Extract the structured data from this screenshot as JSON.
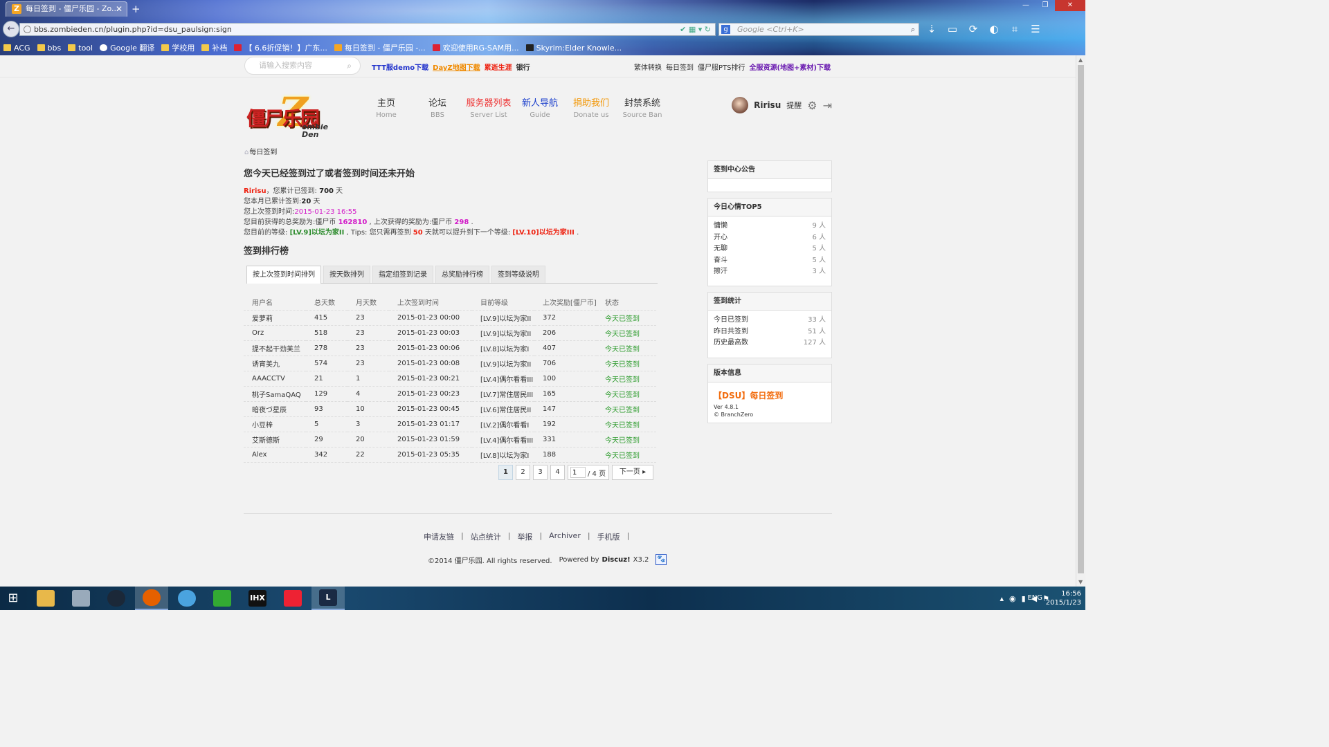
{
  "browser": {
    "tab_title": "每日签到 - 僵尸乐园 - Zo...",
    "tab_favicon": "Z",
    "url": "bbs.zombieden.cn/plugin.php?id=dsu_paulsign:sign",
    "search_placeholder": "Google <Ctrl+K>",
    "bookmarks": [
      {
        "label": "ACG",
        "icon": "folder-icon"
      },
      {
        "label": "bbs",
        "icon": "folder-icon"
      },
      {
        "label": "tool",
        "icon": "folder-icon"
      },
      {
        "label": "Google 翻译",
        "icon": "translate-icon"
      },
      {
        "label": "学校用",
        "icon": "folder-icon"
      },
      {
        "label": "补档",
        "icon": "folder-icon"
      },
      {
        "label": "【 6.6折促销！】广东...",
        "icon": "site-icon"
      },
      {
        "label": "每日签到 - 僵尸乐园 -...",
        "icon": "zombieden-icon"
      },
      {
        "label": "欢迎使用RG-SAM用...",
        "icon": "site-icon"
      },
      {
        "label": "Skyrim:Elder Knowle...",
        "icon": "skyrim-icon"
      }
    ]
  },
  "topstrip": {
    "search_placeholder": "请输入搜索内容",
    "quicklinks": [
      {
        "label": "TTT服demo下载",
        "style": "blue"
      },
      {
        "label": "DayZ地图下载",
        "style": "orange"
      },
      {
        "label": "累逝生涯",
        "style": "red"
      },
      {
        "label": "银行",
        "style": "dark"
      }
    ],
    "right_links": [
      "繁体转换",
      "每日签到",
      "僵尸服PTS排行"
    ],
    "right_highlight": "全服资源(地图+素材)下载"
  },
  "header": {
    "logo": {
      "cn": "僵尸乐园",
      "letter": "Z",
      "en_line1": "ombie",
      "en_line2": "Den"
    },
    "nav": [
      {
        "cn": "主页",
        "en": "Home",
        "style": ""
      },
      {
        "cn": "论坛",
        "en": "BBS",
        "style": ""
      },
      {
        "cn": "服务器列表",
        "en": "Server List",
        "style": "red"
      },
      {
        "cn": "新人导航",
        "en": "Guide",
        "style": "blue"
      },
      {
        "cn": "捐助我们",
        "en": "Donate us",
        "style": "orange"
      },
      {
        "cn": "封禁系统",
        "en": "Source Ban",
        "style": ""
      }
    ],
    "user": {
      "name": "Ririsu",
      "remind": "提醒"
    }
  },
  "breadcrumb": "每日签到",
  "status": {
    "heading": "您今天已经签到过了或者签到时间还未开始",
    "username": "Ririsu",
    "line1_a": "，您累计已签到: ",
    "total_days": "700",
    "line1_b": " 天",
    "line2_a": "您本月已累计签到:",
    "month_days": "20",
    "line2_b": " 天",
    "line3_a": "您上次签到时间:",
    "last_time": "2015-01-23 16:55",
    "line4_a": "您目前获得的总奖励为:僵尸币 ",
    "total_reward": "162810",
    "line4_b": " , 上次获得的奖励为:僵尸币 ",
    "last_reward": "298",
    "line4_c": " .",
    "line5_a": "您目前的等级: ",
    "level": "[LV.9]以坛为家II",
    "line5_b": " , Tips: 您只需再签到 ",
    "need_days": "50",
    "line5_c": " 天就可以提升到下一个等级: ",
    "next_level": "[LV.10]以坛为家III",
    "line5_d": " ."
  },
  "ranking": {
    "heading": "签到排行榜",
    "tabs": [
      "按上次签到时间排列",
      "按天数排列",
      "指定组签到记录",
      "总奖励排行榜",
      "签到等级说明"
    ],
    "columns": [
      "用户名",
      "总天数",
      "月天数",
      "上次签到时间",
      "目前等级",
      "上次奖励[僵尸币]",
      "状态"
    ],
    "rows": [
      [
        "爱萝莉",
        "415",
        "23",
        "2015-01-23 00:00",
        "[LV.9]以坛为家II",
        "372",
        "今天已签到"
      ],
      [
        "Orz",
        "518",
        "23",
        "2015-01-23 00:03",
        "[LV.9]以坛为家II",
        "206",
        "今天已签到"
      ],
      [
        "提不起干劲芙兰",
        "278",
        "23",
        "2015-01-23 00:06",
        "[LV.8]以坛为家I",
        "407",
        "今天已签到"
      ],
      [
        "诱宵美九",
        "574",
        "23",
        "2015-01-23 00:08",
        "[LV.9]以坛为家II",
        "706",
        "今天已签到"
      ],
      [
        "AAACCTV",
        "21",
        "1",
        "2015-01-23 00:21",
        "[LV.4]偶尔看看III",
        "100",
        "今天已签到"
      ],
      [
        "桃子SamaQAQ",
        "129",
        "4",
        "2015-01-23 00:23",
        "[LV.7]常住居民III",
        "165",
        "今天已签到"
      ],
      [
        "暗夜づ星辰",
        "93",
        "10",
        "2015-01-23 00:45",
        "[LV.6]常住居民II",
        "147",
        "今天已签到"
      ],
      [
        "小豆梓",
        "5",
        "3",
        "2015-01-23 01:17",
        "[LV.2]偶尔看看I",
        "192",
        "今天已签到"
      ],
      [
        "艾斯德斯",
        "29",
        "20",
        "2015-01-23 01:59",
        "[LV.4]偶尔看看III",
        "331",
        "今天已签到"
      ],
      [
        "Alex",
        "342",
        "22",
        "2015-01-23 05:35",
        "[LV.8]以坛为家I",
        "188",
        "今天已签到"
      ]
    ]
  },
  "pager": {
    "pages": [
      "1",
      "2",
      "3",
      "4"
    ],
    "current": "1",
    "jump_value": "1",
    "total": "/ 4 页",
    "next": "下一页"
  },
  "sidebar": {
    "notice_title": "签到中心公告",
    "mood_title": "今日心情TOP5",
    "moods": [
      {
        "label": "慵懒",
        "value": "9 人"
      },
      {
        "label": "开心",
        "value": "6 人"
      },
      {
        "label": "无聊",
        "value": "5 人"
      },
      {
        "label": "奋斗",
        "value": "5 人"
      },
      {
        "label": "擦汗",
        "value": "3 人"
      }
    ],
    "stats_title": "签到统计",
    "stats": [
      {
        "label": "今日已签到",
        "value": "33 人"
      },
      {
        "label": "昨日共签到",
        "value": "51 人"
      },
      {
        "label": "历史最高数",
        "value": "127 人"
      }
    ],
    "version_title": "版本信息",
    "version_name": "【DSU】每日签到",
    "version_ver": "Ver 4.8.1",
    "version_author": "© BranchZero"
  },
  "footer": {
    "links": [
      "申请友链",
      "站点统计",
      "举报",
      "Archiver",
      "手机版"
    ],
    "copyright": "©2014  僵尸乐园. All rights reserved.",
    "powered": "Powered by",
    "brand": "Discuz!",
    "version": "X3.2"
  },
  "taskbar": {
    "lang": "ENG",
    "time": "16:56",
    "date": "2015/1/23",
    "apps": [
      {
        "name": "file-explorer-icon",
        "label": "",
        "color": "#e8b84a"
      },
      {
        "name": "control-panel-icon",
        "label": "",
        "color": "#9ab"
      },
      {
        "name": "steam-icon",
        "label": "",
        "color": "#1b2838"
      },
      {
        "name": "firefox-icon",
        "label": "",
        "color": "#e66000"
      },
      {
        "name": "itunes-icon",
        "label": "",
        "color": "#4aa3df"
      },
      {
        "name": "app-green-icon",
        "label": "",
        "color": "#3a3"
      },
      {
        "name": "ihx-icon",
        "label": "IHX",
        "color": "#111"
      },
      {
        "name": "headphones-icon",
        "label": "",
        "color": "#e23"
      },
      {
        "name": "league-icon",
        "label": "L",
        "color": "#1a2a44"
      }
    ]
  }
}
